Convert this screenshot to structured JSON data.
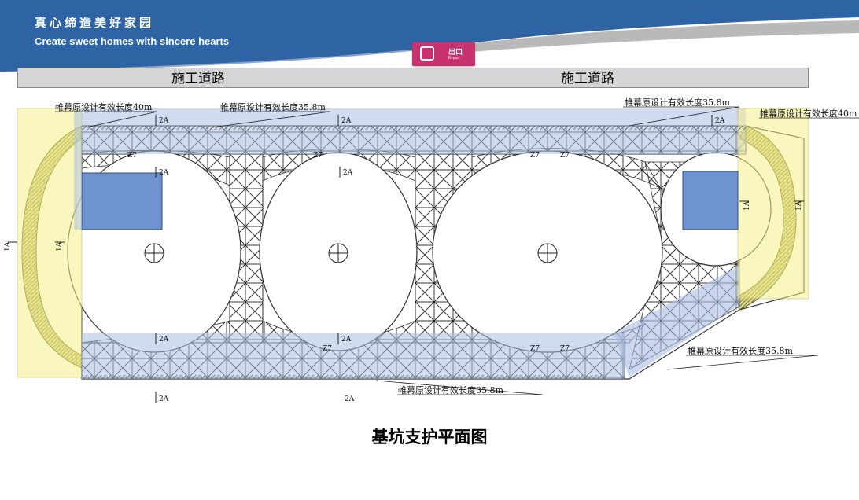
{
  "header": {
    "slogan_cn": "真心缔造美好家园",
    "slogan_en": "Create sweet homes with sincere hearts"
  },
  "export_button": {
    "label": "出口",
    "sublabel": "Export",
    "icon": "exit-icon",
    "color": "#c8326e"
  },
  "road": {
    "left_label": "施工道路",
    "right_label": "施工道路"
  },
  "annotations": {
    "top_left_40": "帷幕原设计有效长度40m",
    "top_mid_358": "帷幕原设计有效长度35.8m",
    "top_right_358": "帷幕原设计有效长度35.8m",
    "right_40": "帷幕原设计有效长度40m",
    "right_lower_358": "帷幕原设计有效长度35.8m",
    "bottom_358": "帷幕原设计有效长度35.8m"
  },
  "section_marks": {
    "mark_2a": "2A",
    "mark_1a": "1A",
    "mark_z7": "Z7"
  },
  "caption": "基坑支护平面图",
  "colors": {
    "banner_blue": "#2f64a4",
    "highlight_blue": "#a9bde3",
    "highlight_yellow": "#f5f08a",
    "pit_block": "#6f93cf",
    "truss": "#3a3a3a",
    "slope_fill": "#9d9a55"
  }
}
